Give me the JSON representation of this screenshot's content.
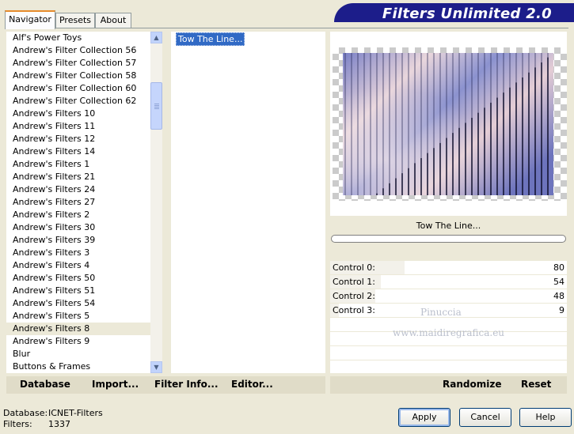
{
  "app": {
    "title": "Filters Unlimited 2.0"
  },
  "tabs": [
    {
      "label": "Navigator",
      "active": true
    },
    {
      "label": "Presets",
      "active": false
    },
    {
      "label": "About",
      "active": false
    }
  ],
  "filter_list": {
    "items": [
      "Alf's Power Toys",
      "Andrew's Filter Collection 56",
      "Andrew's Filter Collection 57",
      "Andrew's Filter Collection 58",
      "Andrew's Filter Collection 60",
      "Andrew's Filter Collection 62",
      "Andrew's Filters 10",
      "Andrew's Filters 11",
      "Andrew's Filters 12",
      "Andrew's Filters 14",
      "Andrew's Filters 1",
      "Andrew's Filters 21",
      "Andrew's Filters 24",
      "Andrew's Filters 27",
      "Andrew's Filters 2",
      "Andrew's Filters 30",
      "Andrew's Filters 39",
      "Andrew's Filters 3",
      "Andrew's Filters 4",
      "Andrew's Filters 50",
      "Andrew's Filters 51",
      "Andrew's Filters 54",
      "Andrew's Filters 5",
      "Andrew's Filters 8",
      "Andrew's Filters 9",
      "Blur",
      "Buttons & Frames"
    ],
    "selected": "Andrew's Filters 8",
    "scroll_icons": {
      "up": "scroll-up-arrow-icon",
      "down": "scroll-down-arrow-icon"
    }
  },
  "effect_list": {
    "items": [
      "Tow The Line..."
    ],
    "selected": "Tow The Line..."
  },
  "preview": {
    "effect_name": "Tow The Line...",
    "progress": 0,
    "colors": {
      "periwinkle": "#7b82c4",
      "pink": "#e6cfd6",
      "dark_line": "#1a1a3a"
    }
  },
  "controls": [
    {
      "label": "Control 0:",
      "value": "80"
    },
    {
      "label": "Control 1:",
      "value": "54"
    },
    {
      "label": "Control 2:",
      "value": "48"
    },
    {
      "label": "Control 3:",
      "value": "9"
    }
  ],
  "watermark": {
    "line1": "Pinuccia",
    "line2": "www.maidiregrafica.eu"
  },
  "left_buttons": {
    "database": "Database",
    "import": "Import...",
    "filter_info": "Filter Info...",
    "editor": "Editor..."
  },
  "right_buttons": {
    "randomize": "Randomize",
    "reset": "Reset"
  },
  "status": {
    "database_label": "Database:",
    "database_value": "ICNET-Filters",
    "filters_label": "Filters:",
    "filters_value": "1337"
  },
  "dialog_buttons": {
    "apply": "Apply",
    "cancel": "Cancel",
    "help": "Help"
  }
}
